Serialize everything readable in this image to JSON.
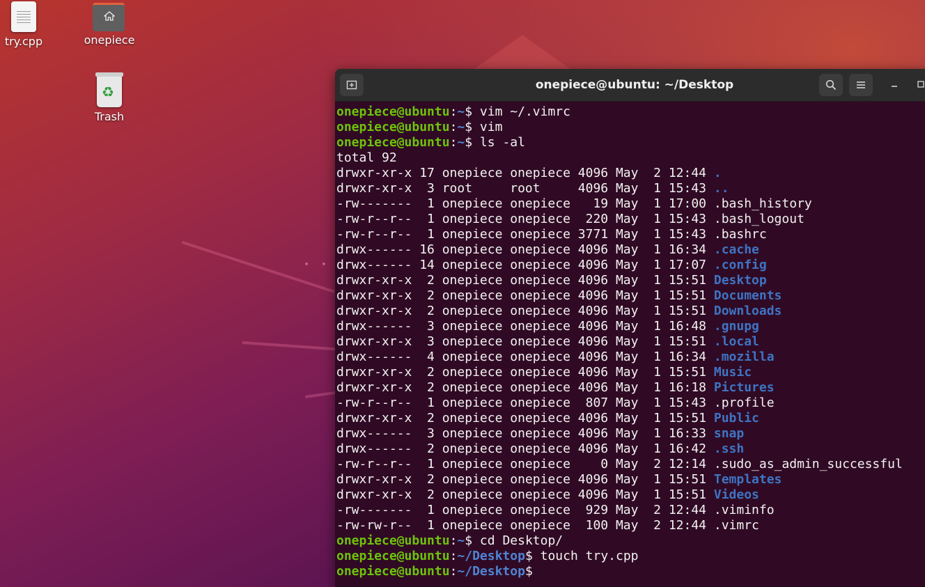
{
  "desktop": {
    "icons": [
      {
        "label": "try.cpp",
        "icon": "text-file-icon"
      },
      {
        "label": "onepiece",
        "icon": "home-folder-icon"
      },
      {
        "label": "Trash",
        "icon": "trash-icon"
      }
    ],
    "colors": {
      "accent": "#e2613c",
      "terminal_bg": "#300a24",
      "prompt_user": "#6ec30b",
      "prompt_path": "#4f84d4",
      "directory": "#3e74c4"
    }
  },
  "terminal": {
    "title": "onepiece@ubuntu: ~/Desktop",
    "buttons": {
      "new_tab": "new-tab-icon",
      "search": "search-icon",
      "menu": "hamburger-menu-icon",
      "minimize": "minimize-icon",
      "maximize": "maximize-icon"
    },
    "prompt_user": "onepiece@ubuntu",
    "lines": [
      {
        "type": "prompt",
        "path": "~",
        "cmd": " vim ~/.vimrc"
      },
      {
        "type": "prompt",
        "path": "~",
        "cmd": " vim"
      },
      {
        "type": "prompt",
        "path": "~",
        "cmd": " ls -al"
      },
      {
        "type": "text",
        "text": "total 92"
      },
      {
        "type": "entry",
        "meta": "drwxr-xr-x 17 onepiece onepiece 4096 May  2 12:44 ",
        "name": ".",
        "dir": true
      },
      {
        "type": "entry",
        "meta": "drwxr-xr-x  3 root     root     4096 May  1 15:43 ",
        "name": "..",
        "dir": true
      },
      {
        "type": "entry",
        "meta": "-rw-------  1 onepiece onepiece   19 May  1 17:00 ",
        "name": ".bash_history",
        "dir": false
      },
      {
        "type": "entry",
        "meta": "-rw-r--r--  1 onepiece onepiece  220 May  1 15:43 ",
        "name": ".bash_logout",
        "dir": false
      },
      {
        "type": "entry",
        "meta": "-rw-r--r--  1 onepiece onepiece 3771 May  1 15:43 ",
        "name": ".bashrc",
        "dir": false
      },
      {
        "type": "entry",
        "meta": "drwx------ 16 onepiece onepiece 4096 May  1 16:34 ",
        "name": ".cache",
        "dir": true
      },
      {
        "type": "entry",
        "meta": "drwx------ 14 onepiece onepiece 4096 May  1 17:07 ",
        "name": ".config",
        "dir": true
      },
      {
        "type": "entry",
        "meta": "drwxr-xr-x  2 onepiece onepiece 4096 May  1 15:51 ",
        "name": "Desktop",
        "dir": true
      },
      {
        "type": "entry",
        "meta": "drwxr-xr-x  2 onepiece onepiece 4096 May  1 15:51 ",
        "name": "Documents",
        "dir": true
      },
      {
        "type": "entry",
        "meta": "drwxr-xr-x  2 onepiece onepiece 4096 May  1 15:51 ",
        "name": "Downloads",
        "dir": true
      },
      {
        "type": "entry",
        "meta": "drwx------  3 onepiece onepiece 4096 May  1 16:48 ",
        "name": ".gnupg",
        "dir": true
      },
      {
        "type": "entry",
        "meta": "drwxr-xr-x  3 onepiece onepiece 4096 May  1 15:51 ",
        "name": ".local",
        "dir": true
      },
      {
        "type": "entry",
        "meta": "drwx------  4 onepiece onepiece 4096 May  1 16:34 ",
        "name": ".mozilla",
        "dir": true
      },
      {
        "type": "entry",
        "meta": "drwxr-xr-x  2 onepiece onepiece 4096 May  1 15:51 ",
        "name": "Music",
        "dir": true
      },
      {
        "type": "entry",
        "meta": "drwxr-xr-x  2 onepiece onepiece 4096 May  1 16:18 ",
        "name": "Pictures",
        "dir": true
      },
      {
        "type": "entry",
        "meta": "-rw-r--r--  1 onepiece onepiece  807 May  1 15:43 ",
        "name": ".profile",
        "dir": false
      },
      {
        "type": "entry",
        "meta": "drwxr-xr-x  2 onepiece onepiece 4096 May  1 15:51 ",
        "name": "Public",
        "dir": true
      },
      {
        "type": "entry",
        "meta": "drwx------  3 onepiece onepiece 4096 May  1 16:33 ",
        "name": "snap",
        "dir": true
      },
      {
        "type": "entry",
        "meta": "drwx------  2 onepiece onepiece 4096 May  1 16:42 ",
        "name": ".ssh",
        "dir": true
      },
      {
        "type": "entry",
        "meta": "-rw-r--r--  1 onepiece onepiece    0 May  2 12:14 ",
        "name": ".sudo_as_admin_successful",
        "dir": false
      },
      {
        "type": "entry",
        "meta": "drwxr-xr-x  2 onepiece onepiece 4096 May  1 15:51 ",
        "name": "Templates",
        "dir": true
      },
      {
        "type": "entry",
        "meta": "drwxr-xr-x  2 onepiece onepiece 4096 May  1 15:51 ",
        "name": "Videos",
        "dir": true
      },
      {
        "type": "entry",
        "meta": "-rw-------  1 onepiece onepiece  929 May  2 12:44 ",
        "name": ".viminfo",
        "dir": false
      },
      {
        "type": "entry",
        "meta": "-rw-rw-r--  1 onepiece onepiece  100 May  2 12:44 ",
        "name": ".vimrc",
        "dir": false
      },
      {
        "type": "prompt",
        "path": "~",
        "cmd": " cd Desktop/"
      },
      {
        "type": "prompt",
        "path": "~/Desktop",
        "cmd": " touch try.cpp"
      },
      {
        "type": "prompt",
        "path": "~/Desktop",
        "cmd": " "
      }
    ]
  }
}
